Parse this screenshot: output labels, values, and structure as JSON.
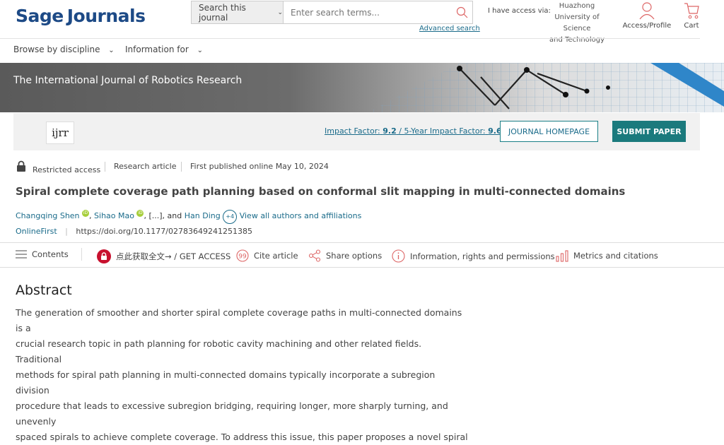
{
  "header": {
    "logo_sage": "Sage",
    "logo_journals": "Journals",
    "search_scope": "Search this journal",
    "search_placeholder": "Enter search terms...",
    "advanced_search": "Advanced search",
    "access_label": "I have access via:",
    "institution_line1": "Huazhong",
    "institution_line2": "University of Science",
    "institution_line3": "and Technology",
    "access_profile": "Access/Profile",
    "cart": "Cart"
  },
  "nav": {
    "browse": "Browse by discipline",
    "info": "Information for"
  },
  "banner": {
    "journal_title": "The International Journal of Robotics Research"
  },
  "journal_bar": {
    "logo_text": "ijrr",
    "impact_factor_label": "Impact Factor:",
    "impact_factor": "9.2",
    "five_year_label": "5-Year Impact Factor:",
    "five_year": "9.6",
    "home_button": "JOURNAL HOMEPAGE",
    "submit_button": "SUBMIT PAPER"
  },
  "article": {
    "access": "Restricted access",
    "type": "Research article",
    "published": "First published online May 10, 2024",
    "title": "Spiral complete coverage path planning based on conformal slit mapping in multi-connected domains",
    "author1": "Changqing Shen",
    "author2": "Sihao Mao",
    "ellipsis": "[...], and",
    "author3": "Han Ding",
    "more_count": "+4",
    "view_all": "View all authors and affiliations",
    "status": "OnlineFirst",
    "doi": "https://doi.org/10.1177/02783649241251385"
  },
  "toolbar": {
    "contents": "Contents",
    "access": "点此获取全文→ / GET ACCESS",
    "cite": "Cite article",
    "share": "Share options",
    "info": "Information, rights and permissions",
    "metrics": "Metrics and citations"
  },
  "abstract": {
    "heading": "Abstract",
    "line1": "The generation of smoother and shorter spiral complete coverage paths in multi-connected domains is a",
    "line2": "crucial research topic in path planning for robotic cavity machining and other related fields. Traditional",
    "line3": "methods for spiral path planning in multi-connected domains typically incorporate a subregion division",
    "line4": "procedure that leads to excessive subregion bridging, requiring longer, more sharply turning, and unevenly",
    "line5": "spaced spirals to achieve complete coverage. To address this issue, this paper proposes a novel spiral"
  },
  "colors": {
    "brand": "#1d4a86",
    "link": "#1a6b8a",
    "submit_bg": "#1b7a7d",
    "lock_red": "#c8102e",
    "orcid": "#a6ce39"
  }
}
